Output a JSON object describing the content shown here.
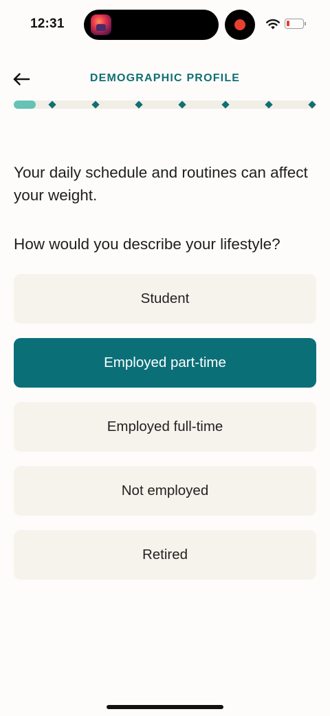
{
  "status_bar": {
    "time": "12:31",
    "battery_level": 0.1,
    "battery_color": "#e53935",
    "recording_color": "#e8412f"
  },
  "header": {
    "back_icon": "arrow-left-icon",
    "title": "DEMOGRAPHIC PROFILE"
  },
  "progress": {
    "total_steps": 8,
    "current_step": 1,
    "fill_color": "#66c2b5",
    "dot_color": "#0f6f74"
  },
  "content": {
    "intro": "Your daily schedule and routines can affect your weight.",
    "question": "How would you describe your lifestyle?"
  },
  "options": [
    {
      "label": "Student",
      "selected": false
    },
    {
      "label": "Employed part-time",
      "selected": true
    },
    {
      "label": "Employed full-time",
      "selected": false
    },
    {
      "label": "Not employed",
      "selected": false
    },
    {
      "label": "Retired",
      "selected": false
    }
  ],
  "colors": {
    "accent": "#0b6f78",
    "option_bg": "#f6f3ec",
    "page_bg": "#fdfcfa"
  }
}
